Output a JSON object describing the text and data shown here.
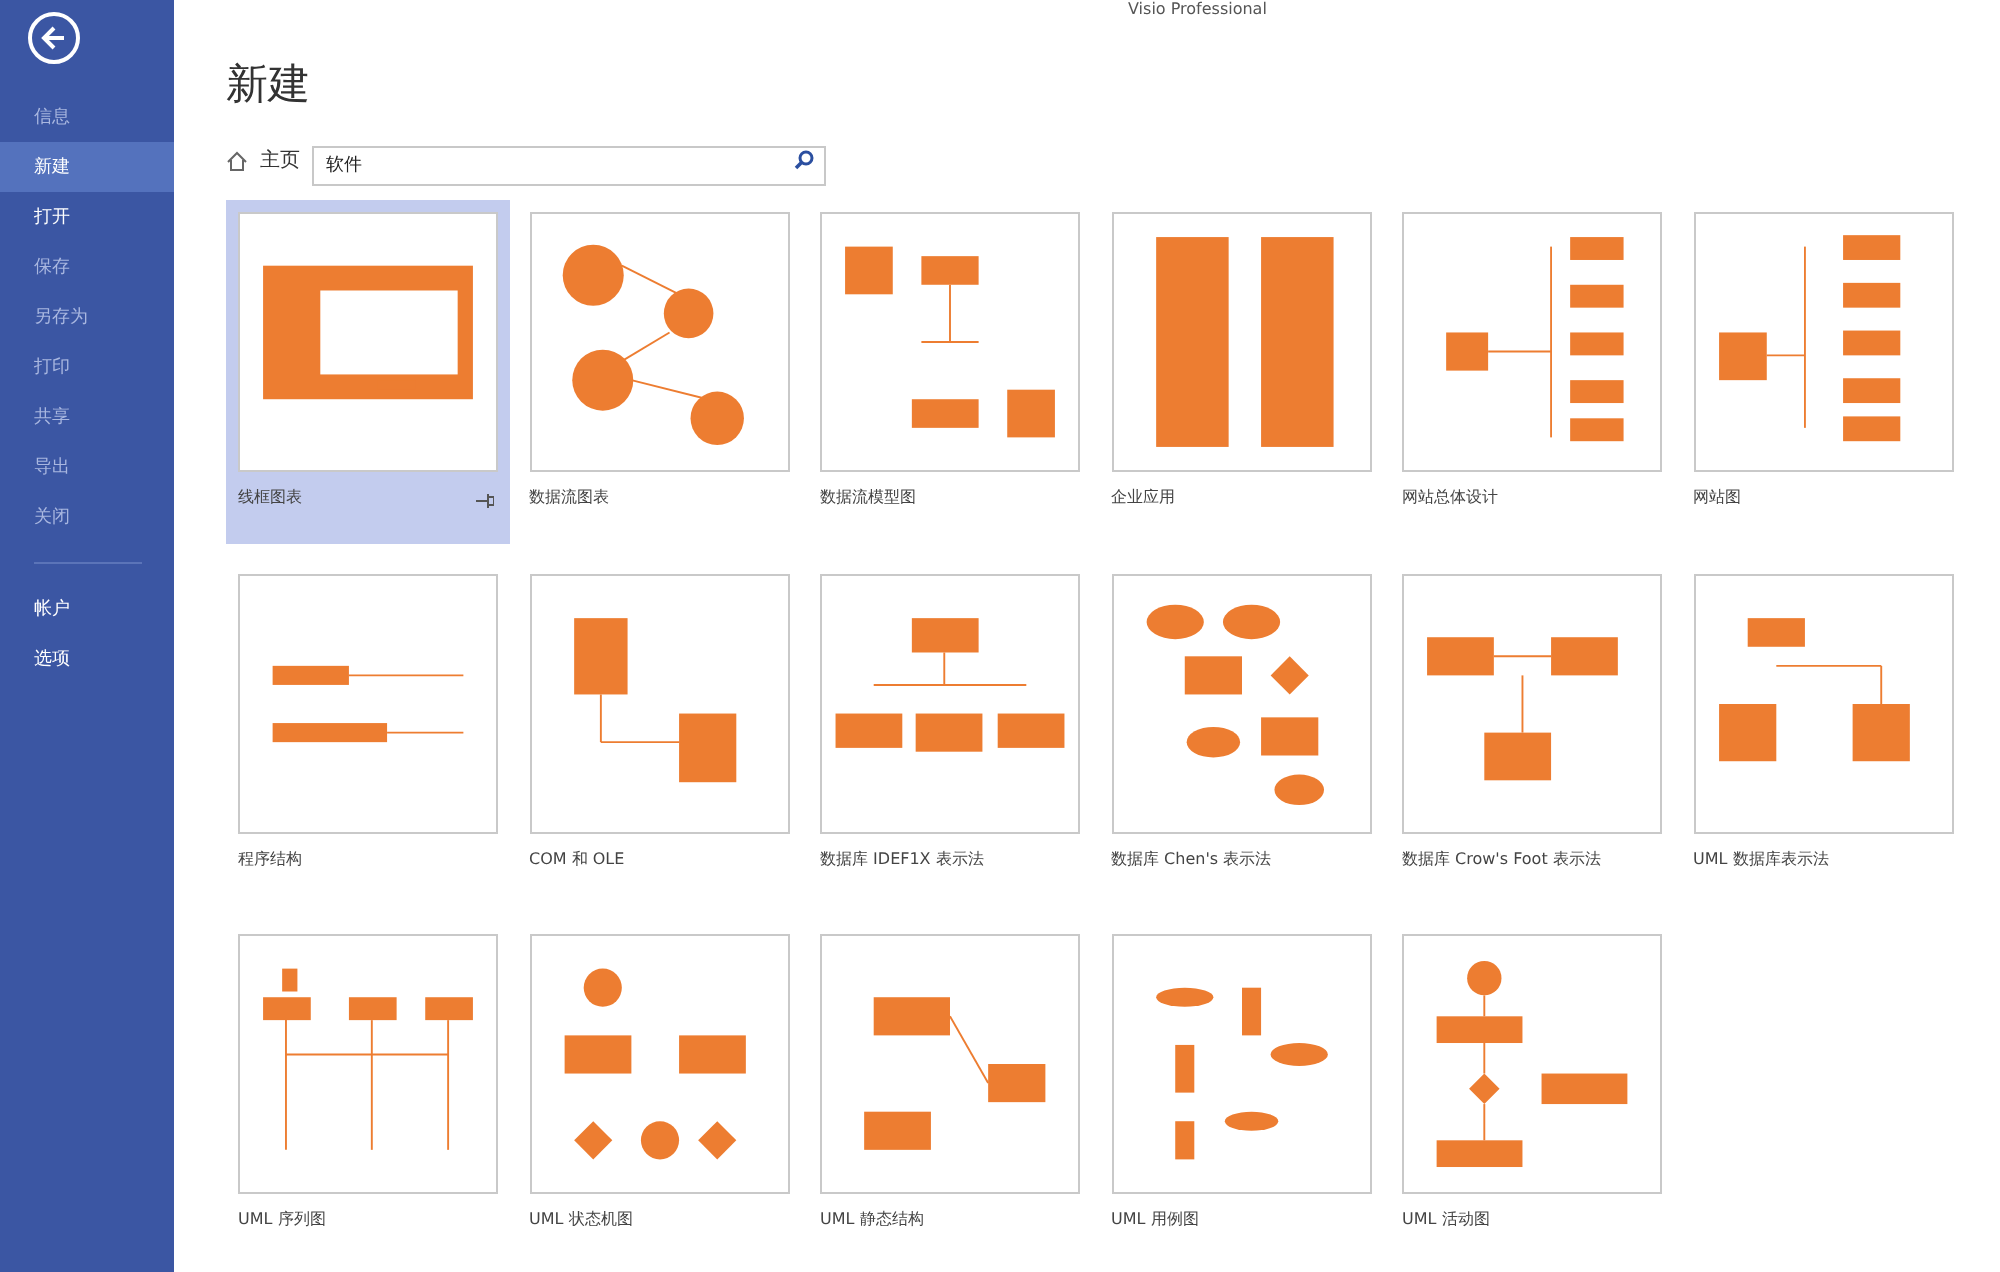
{
  "window": {
    "title": "Visio Professional"
  },
  "sidebar": {
    "items": [
      {
        "label": "信息",
        "selected": false,
        "disabled": true
      },
      {
        "label": "新建",
        "selected": true,
        "disabled": false
      },
      {
        "label": "打开",
        "selected": false,
        "disabled": false
      },
      {
        "label": "保存",
        "selected": false,
        "disabled": true
      },
      {
        "label": "另存为",
        "selected": false,
        "disabled": true
      },
      {
        "label": "打印",
        "selected": false,
        "disabled": true
      },
      {
        "label": "共享",
        "selected": false,
        "disabled": true
      },
      {
        "label": "导出",
        "selected": false,
        "disabled": true
      },
      {
        "label": "关闭",
        "selected": false,
        "disabled": true
      }
    ],
    "bottom_items": [
      {
        "label": "帐户",
        "selected": false
      },
      {
        "label": "选项",
        "selected": false
      }
    ]
  },
  "heading": "新建",
  "breadcrumb": {
    "home": "主页"
  },
  "search": {
    "value": "软件"
  },
  "templates": [
    {
      "label": "线框图表",
      "selected": true
    },
    {
      "label": "数据流图表",
      "selected": false
    },
    {
      "label": "数据流模型图",
      "selected": false
    },
    {
      "label": "企业应用",
      "selected": false
    },
    {
      "label": "网站总体设计",
      "selected": false
    },
    {
      "label": "网站图",
      "selected": false
    },
    {
      "label": "程序结构",
      "selected": false
    },
    {
      "label": "COM 和 OLE",
      "selected": false
    },
    {
      "label": "数据库 IDEF1X 表示法",
      "selected": false
    },
    {
      "label": "数据库 Chen's  表示法",
      "selected": false
    },
    {
      "label": "数据库 Crow's Foot 表示法",
      "selected": false
    },
    {
      "label": "UML 数据库表示法",
      "selected": false
    },
    {
      "label": "UML 序列图",
      "selected": false
    },
    {
      "label": "UML 状态机图",
      "selected": false
    },
    {
      "label": "UML 静态结构",
      "selected": false
    },
    {
      "label": "UML 用例图",
      "selected": false
    },
    {
      "label": "UML 活动图",
      "selected": false
    }
  ]
}
